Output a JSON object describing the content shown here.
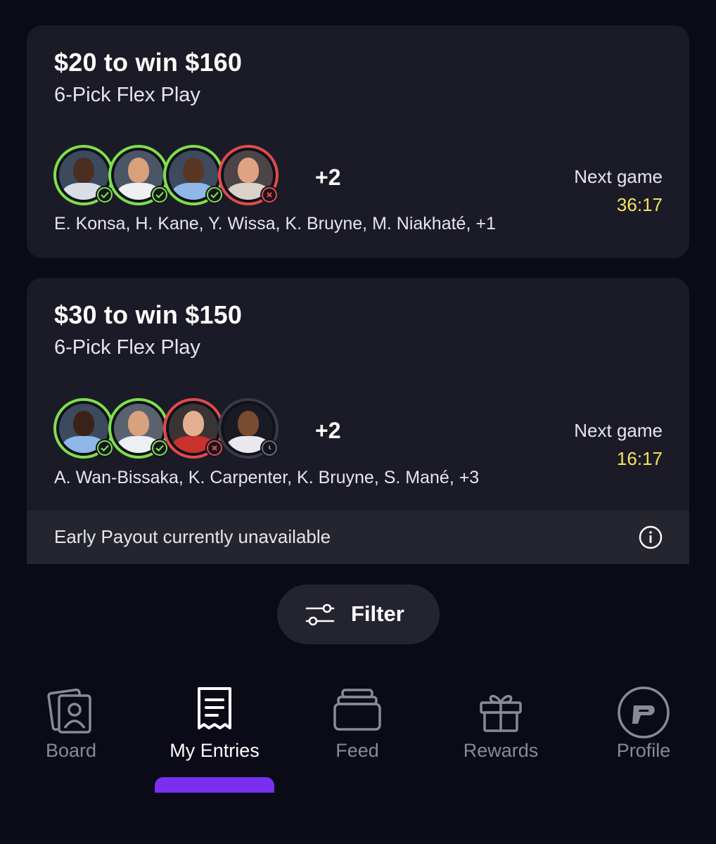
{
  "entries": [
    {
      "title": "$20 to win $160",
      "subtitle": "6-Pick Flex Play",
      "extra_count": "+2",
      "names": "E. Konsa, H. Kane, Y. Wissa, K. Bruyne, M. Niakhaté, +1",
      "next_game_label": "Next game",
      "next_game_time": "36:17",
      "picks": [
        {
          "status": "won",
          "status_icon": "check-icon"
        },
        {
          "status": "won",
          "status_icon": "check-icon"
        },
        {
          "status": "won",
          "status_icon": "check-icon"
        },
        {
          "status": "lost",
          "status_icon": "x-icon"
        }
      ]
    },
    {
      "title": "$30 to win $150",
      "subtitle": "6-Pick Flex Play",
      "extra_count": "+2",
      "names": "A. Wan-Bissaka, K. Carpenter, K. Bruyne, S. Mané, +3",
      "next_game_label": "Next game",
      "next_game_time": "16:17",
      "early_payout": "Early Payout currently unavailable",
      "picks": [
        {
          "status": "won",
          "status_icon": "check-icon"
        },
        {
          "status": "won",
          "status_icon": "check-icon"
        },
        {
          "status": "lost",
          "status_icon": "x-icon"
        },
        {
          "status": "pending",
          "status_icon": "clock-icon"
        }
      ]
    }
  ],
  "filter": {
    "label": "Filter",
    "icon": "sliders-icon"
  },
  "nav": {
    "items": [
      {
        "label": "Board",
        "icon": "board-icon",
        "active": false
      },
      {
        "label": "My Entries",
        "icon": "receipt-icon",
        "active": true
      },
      {
        "label": "Feed",
        "icon": "feed-icon",
        "active": false
      },
      {
        "label": "Rewards",
        "icon": "gift-icon",
        "active": false
      },
      {
        "label": "Profile",
        "icon": "profile-logo-icon",
        "active": false
      }
    ]
  },
  "colors": {
    "background": "#0b0b17",
    "card": "#1b1b27",
    "won": "#7ee04b",
    "lost": "#e24b4b",
    "pending": "#3a3a48",
    "timer": "#f6e35b",
    "accent": "#7a2ff0"
  }
}
